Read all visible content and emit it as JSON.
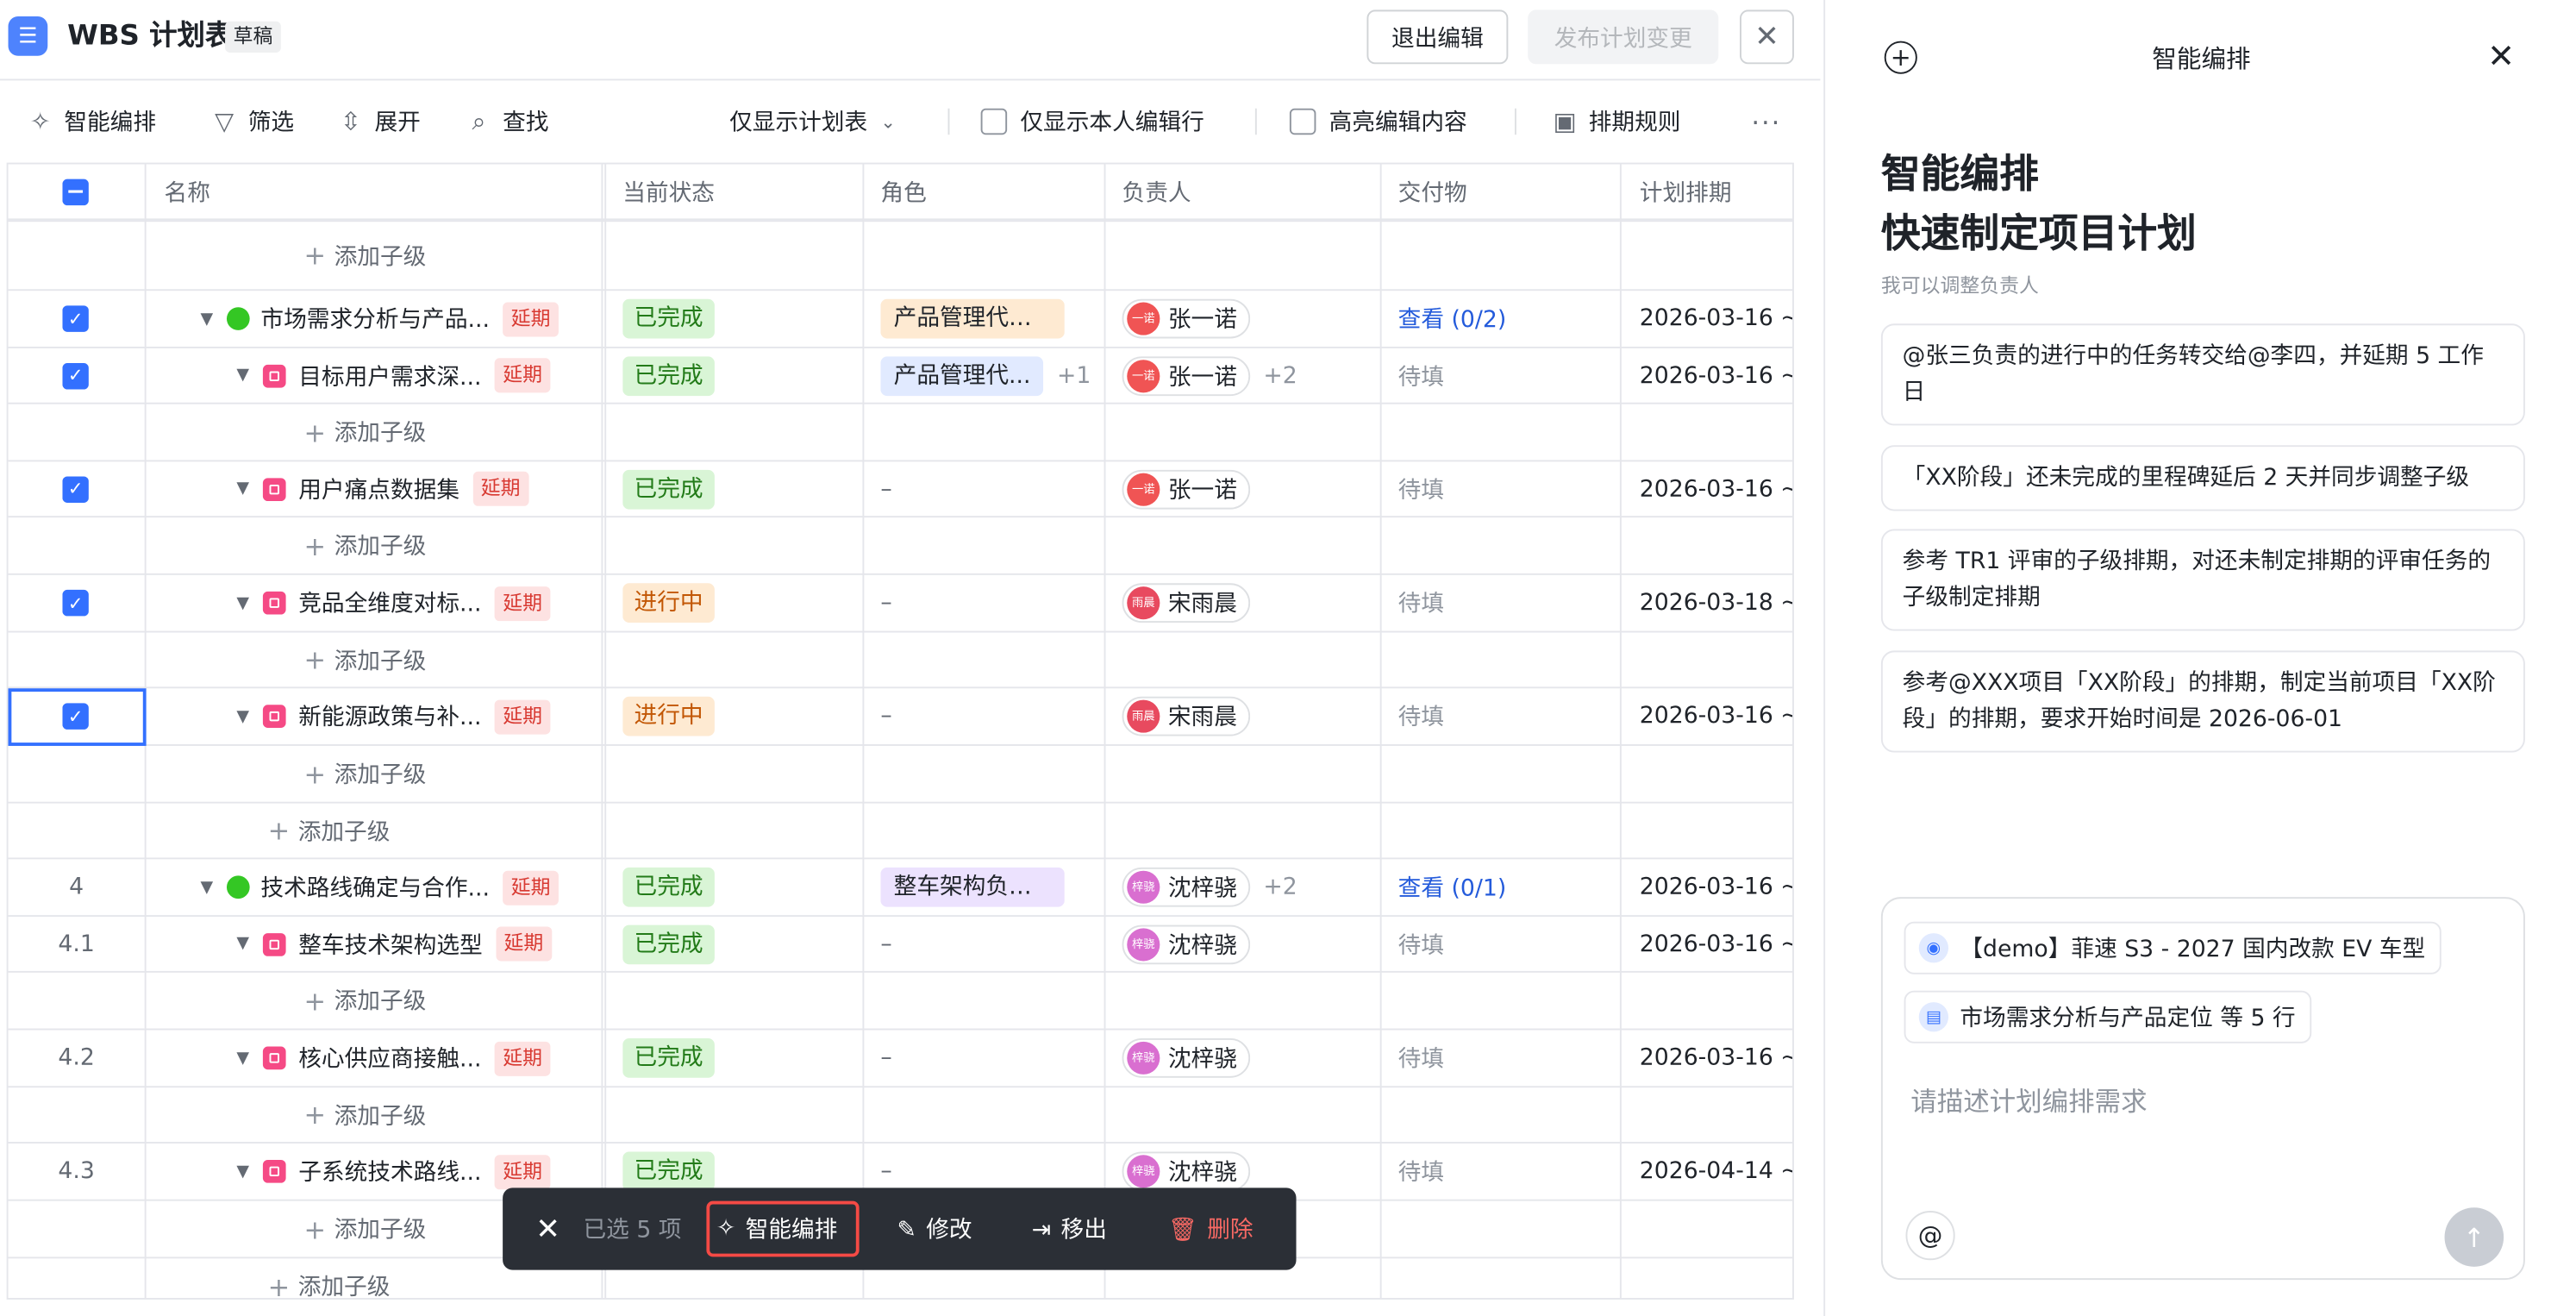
{
  "header": {
    "app_icon": "list-icon",
    "title": "WBS 计划表",
    "draft_badge": "草稿",
    "exit_edit": "退出编辑",
    "publish": "发布计划变更",
    "close_icon": "close-icon"
  },
  "toolbar": {
    "smart": "智能编排",
    "filter": "筛选",
    "expand": "展开",
    "find": "查找",
    "view": "仅显示计划表",
    "only_mine": "仅显示本人编辑行",
    "highlight": "高亮编辑内容",
    "rule": "排期规则",
    "more": "···"
  },
  "columns": {
    "name": "名称",
    "status": "当前状态",
    "role": "角色",
    "owner": "负责人",
    "deliverable": "交付物",
    "plan": "计划排期"
  },
  "rows": [
    {
      "type": "add",
      "label": "添加子级"
    },
    {
      "type": "task",
      "checked": true,
      "level": 1,
      "icon": "circle",
      "name": "市场需求分析与产品...",
      "delay": "延期",
      "status": "已完成",
      "role": "产品管理代表...",
      "owner": "张一诺",
      "owner_av": "一诺",
      "deliverable": "查看 (0/2)",
      "plan": "2026-03-16 ~"
    },
    {
      "type": "task",
      "checked": true,
      "level": 2,
      "icon": "task",
      "name": "目标用户需求深...",
      "delay": "延期",
      "status": "已完成",
      "role": "产品管理代...",
      "role_more": "+1",
      "owner": "张一诺",
      "owner_av": "一诺",
      "owner_more": "+2",
      "deliverable": "待填",
      "plan": "2026-03-16 ~"
    },
    {
      "type": "add",
      "label": "添加子级"
    },
    {
      "type": "task",
      "checked": true,
      "level": 2,
      "icon": "task",
      "name": "用户痛点数据集",
      "delay": "延期",
      "status": "已完成",
      "role": "–",
      "owner": "张一诺",
      "owner_av": "一诺",
      "deliverable": "待填",
      "plan": "2026-03-16 ~"
    },
    {
      "type": "add",
      "label": "添加子级"
    },
    {
      "type": "task",
      "checked": true,
      "level": 2,
      "icon": "task",
      "name": "竞品全维度对标...",
      "delay": "延期",
      "status": "进行中",
      "role": "–",
      "owner": "宋雨晨",
      "owner_av": "雨晨",
      "deliverable": "待填",
      "plan": "2026-03-18 ~"
    },
    {
      "type": "add",
      "label": "添加子级"
    },
    {
      "type": "task",
      "checked": true,
      "level": 2,
      "icon": "task",
      "name": "新能源政策与补...",
      "delay": "延期",
      "status": "进行中",
      "role": "–",
      "owner": "宋雨晨",
      "owner_av": "雨晨",
      "deliverable": "待填",
      "plan": "2026-03-16 ~"
    },
    {
      "type": "add",
      "label": "添加子级"
    },
    {
      "type": "add",
      "label": "添加子级",
      "level": 1
    },
    {
      "type": "task",
      "num": "4",
      "level": 1,
      "icon": "circle",
      "name": "技术路线确定与合作...",
      "delay": "延期",
      "status": "已完成",
      "role": "整车架构负责...",
      "owner": "沈梓骁",
      "owner_av": "梓骁",
      "owner_more": "+2",
      "deliverable": "查看 (0/1)",
      "plan": "2026-03-16 ~"
    },
    {
      "type": "task",
      "num": "4.1",
      "level": 2,
      "icon": "task",
      "name": "整车技术架构选型",
      "delay": "延期",
      "status": "已完成",
      "role": "–",
      "owner": "沈梓骁",
      "owner_av": "梓骁",
      "deliverable": "待填",
      "plan": "2026-03-16 ~"
    },
    {
      "type": "add",
      "label": "添加子级"
    },
    {
      "type": "task",
      "num": "4.2",
      "level": 2,
      "icon": "task",
      "name": "核心供应商接触...",
      "delay": "延期",
      "status": "已完成",
      "role": "–",
      "owner": "沈梓骁",
      "owner_av": "梓骁",
      "deliverable": "待填",
      "plan": "2026-03-16 ~"
    },
    {
      "type": "add",
      "label": "添加子级"
    },
    {
      "type": "task",
      "num": "4.3",
      "level": 2,
      "icon": "task",
      "name": "子系统技术路线...",
      "delay": "延期",
      "status": "已完成",
      "role": "–",
      "owner": "沈梓骁",
      "owner_av": "梓骁",
      "deliverable": "待填",
      "plan": "2026-04-14 ~"
    },
    {
      "type": "add",
      "label": "添加子级"
    },
    {
      "type": "add",
      "label": "添加子级",
      "level": 1
    }
  ],
  "actionbar": {
    "selected": "已选 5 项",
    "smart": "智能编排",
    "edit": "修改",
    "move": "移出",
    "delete": "删除"
  },
  "panel": {
    "title": "智能编排",
    "heading_1": "智能编排",
    "heading_2": "快速制定项目计划",
    "subtitle": "我可以调整负责人",
    "suggestions": [
      "@张三负责的进行中的任务转交给@李四，并延期 5 工作日",
      "「XX阶段」还未完成的里程碑延后 2 天并同步调整子级",
      "参考 TR1 评审的子级排期，对还未制定排期的评审任务的子级制定排期",
      "参考@XXX项目「XX阶段」的排期，制定当前项目「XX阶段」的排期，要求开始时间是 2026-06-01"
    ],
    "chip_project": "【demo】菲速 S3 - 2027 国内改款 EV 车型",
    "chip_rows": "市场需求分析与产品定位 等 5 行",
    "placeholder": "请描述计划编排需求",
    "at": "@",
    "send_icon": "arrow-up-icon"
  },
  "colors": {
    "accent": "#3370ff",
    "done_bg": "#d9f5d6",
    "doing_bg": "#feead2",
    "delay_bg": "#fde2e2",
    "delete_red": "#f54a45"
  }
}
